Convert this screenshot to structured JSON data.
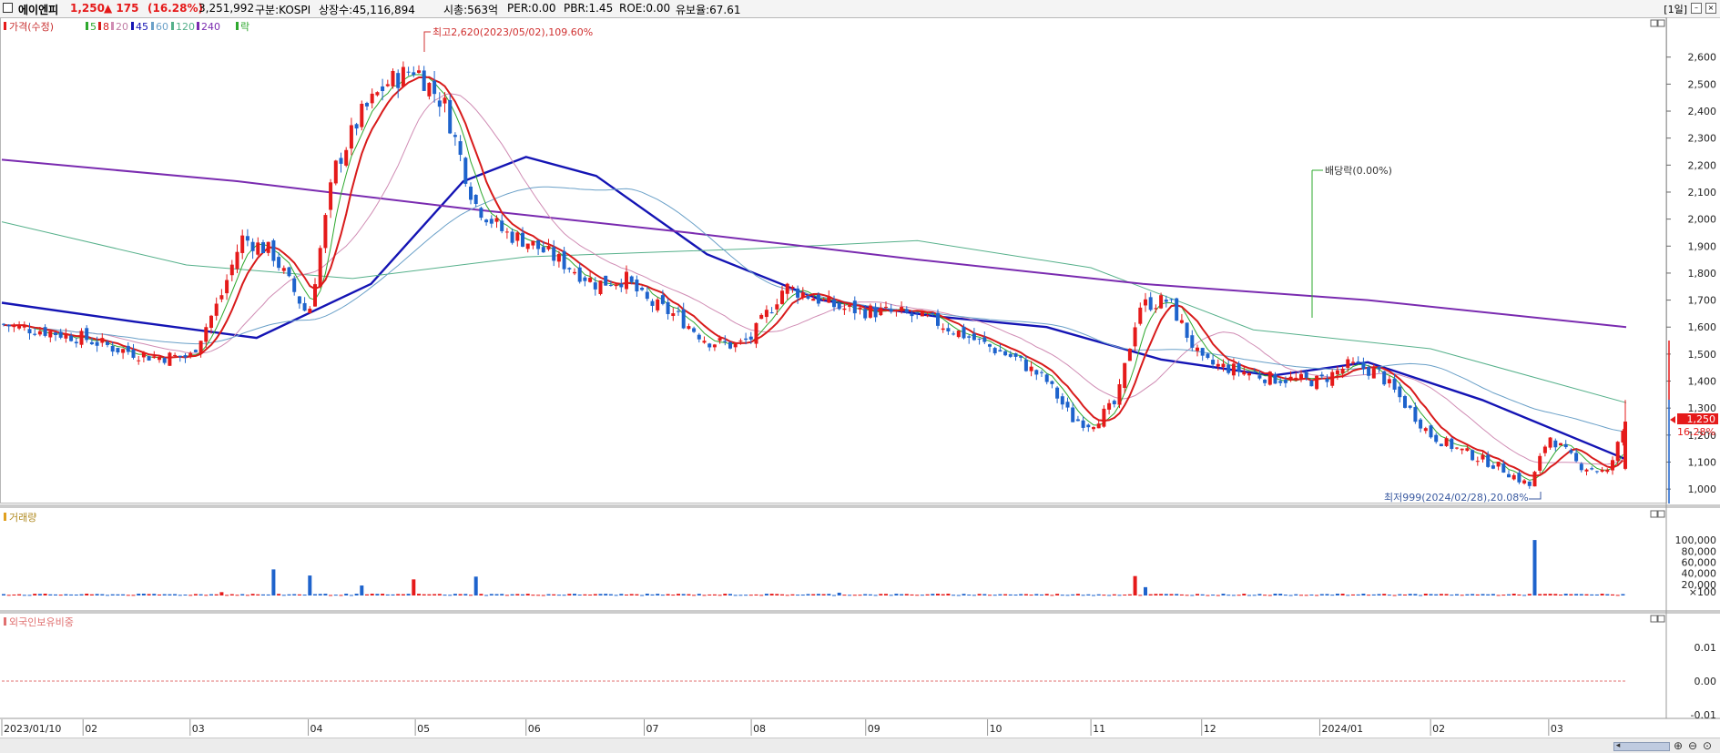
{
  "header": {
    "stock_name": "에이엔피",
    "price": "1,250",
    "change": "▲ 175",
    "change_pct": "(16.28%)",
    "volume": "3,251,992",
    "market": "구분:KOSPI",
    "shares": "상장수:45,116,894",
    "mktcap": "시총:563억",
    "per": "PER:0.00",
    "pbr": "PBR:1.45",
    "roe": "ROE:0.00",
    "float_ratio": "유보율:67.61",
    "period": "[1일]"
  },
  "legend": {
    "price_label": "가격(수정)",
    "ma_labels": [
      "5",
      "8",
      "20",
      "45",
      "60",
      "120",
      "240"
    ],
    "ex_label": "락",
    "volume_label": "거래량",
    "foreign_label": "외국인보유비중"
  },
  "annotations": {
    "high": "최고2,620(2023/05/02),109.60%",
    "low": "최저999(2024/02/28),20.08%",
    "dividend": "배당락(0.00%)",
    "current_price": "1,250",
    "current_pct": "16.28%"
  },
  "colors": {
    "up": "#e51a1a",
    "down": "#1e63cc",
    "ma5": "#2ea82e",
    "ma8": "#d81b1b",
    "ma20": "#d08cb4",
    "ma45": "#1414b4",
    "ma60": "#6aa0c8",
    "ma120": "#55b08a",
    "ma240": "#7a2bb0"
  },
  "chart_data": [
    {
      "type": "candlestick",
      "title": "",
      "y_ticks": [
        "1,000",
        "1,100",
        "1,200",
        "1,300",
        "1,400",
        "1,500",
        "1,600",
        "1,700",
        "1,800",
        "1,900",
        "2,000",
        "2,100",
        "2,200",
        "2,300",
        "2,400",
        "2,500",
        "2,600"
      ],
      "ylim": [
        960,
        2680
      ],
      "x_labels": [
        "2023/01/10",
        "02",
        "03",
        "04",
        "05",
        "06",
        "07",
        "08",
        "09",
        "10",
        "11",
        "12",
        "2024/01",
        "02",
        "03"
      ],
      "x_dates": [
        "2023-01-10",
        "2023-02-01",
        "2023-03-02",
        "2023-04-03",
        "2023-05-02",
        "2023-06-01",
        "2023-07-03",
        "2023-08-01",
        "2023-09-01",
        "2023-10-04",
        "2023-11-01",
        "2023-12-01",
        "2024-01-02",
        "2024-02-01",
        "2024-03-04"
      ],
      "x_range": [
        "2023-01-10",
        "2024-03-25"
      ],
      "series": [
        {
          "name": "가격(수정)",
          "x": [
            "2023-01-10",
            "2023-01-20",
            "2023-02-01",
            "2023-02-10",
            "2023-02-20",
            "2023-03-02",
            "2023-03-10",
            "2023-03-16",
            "2023-03-24",
            "2023-04-03",
            "2023-04-10",
            "2023-04-17",
            "2023-04-24",
            "2023-05-02",
            "2023-05-10",
            "2023-05-18",
            "2023-05-26",
            "2023-06-01",
            "2023-06-12",
            "2023-06-20",
            "2023-06-28",
            "2023-07-03",
            "2023-07-12",
            "2023-07-20",
            "2023-07-28",
            "2023-08-01",
            "2023-08-10",
            "2023-08-18",
            "2023-08-25",
            "2023-09-01",
            "2023-09-11",
            "2023-09-20",
            "2023-10-04",
            "2023-10-12",
            "2023-10-20",
            "2023-10-27",
            "2023-11-01",
            "2023-11-08",
            "2023-11-14",
            "2023-11-22",
            "2023-12-01",
            "2023-12-11",
            "2023-12-20",
            "2024-01-02",
            "2024-01-10",
            "2024-01-18",
            "2024-01-26",
            "2024-02-01",
            "2024-02-08",
            "2024-02-20",
            "2024-02-28",
            "2024-03-04",
            "2024-03-12",
            "2024-03-20",
            "2024-03-25"
          ],
          "y": [
            1610,
            1590,
            1560,
            1520,
            1490,
            1490,
            1700,
            1930,
            1880,
            1640,
            2180,
            2380,
            2500,
            2560,
            2420,
            2060,
            1950,
            1920,
            1830,
            1760,
            1780,
            1700,
            1640,
            1550,
            1530,
            1560,
            1750,
            1710,
            1670,
            1660,
            1650,
            1620,
            1530,
            1480,
            1400,
            1260,
            1240,
            1320,
            1680,
            1700,
            1470,
            1440,
            1410,
            1400,
            1460,
            1430,
            1300,
            1200,
            1150,
            1080,
            1010,
            1200,
            1090,
            1060,
            1250
          ]
        },
        {
          "name": "5",
          "x": [],
          "y": []
        },
        {
          "name": "8",
          "x": [],
          "y": []
        },
        {
          "name": "20",
          "x": [],
          "y": []
        },
        {
          "name": "45",
          "x": [
            "2023-01-10",
            "2023-02-15",
            "2023-03-20",
            "2023-04-20",
            "2023-05-15",
            "2023-06-01",
            "2023-06-20",
            "2023-07-20",
            "2023-08-20",
            "2023-09-20",
            "2023-10-20",
            "2023-11-20",
            "2023-12-20",
            "2024-01-15",
            "2024-02-15",
            "2024-03-25"
          ],
          "y": [
            1690,
            1620,
            1560,
            1760,
            2140,
            2230,
            2160,
            1870,
            1700,
            1640,
            1600,
            1480,
            1420,
            1470,
            1330,
            1110
          ]
        },
        {
          "name": "60",
          "x": [],
          "y": []
        },
        {
          "name": "120",
          "x": [
            "2023-01-10",
            "2023-03-01",
            "2023-04-15",
            "2023-06-01",
            "2023-08-01",
            "2023-09-15",
            "2023-11-01",
            "2023-12-15",
            "2024-02-01",
            "2024-03-25"
          ],
          "y": [
            1990,
            1830,
            1780,
            1860,
            1890,
            1920,
            1820,
            1590,
            1520,
            1320
          ]
        },
        {
          "name": "240",
          "x": [
            "2023-01-10",
            "2023-03-15",
            "2023-05-15",
            "2023-07-15",
            "2023-09-15",
            "2023-11-15",
            "2024-01-15",
            "2024-03-25"
          ],
          "y": [
            2220,
            2140,
            2040,
            1950,
            1850,
            1760,
            1700,
            1600
          ]
        }
      ]
    },
    {
      "type": "bar",
      "title": "거래량",
      "y_ticks": [
        "×100",
        "20,000",
        "40,000",
        "60,000",
        "80,000",
        "100,000"
      ],
      "ylim": [
        0,
        110000
      ],
      "series": [
        {
          "name": "거래량",
          "x": [
            "2023-01-10",
            "2023-02-10",
            "2023-03-10",
            "2023-03-24",
            "2023-04-03",
            "2023-04-17",
            "2023-05-02",
            "2023-05-18",
            "2023-06-20",
            "2023-08-25",
            "2023-11-13",
            "2023-11-16",
            "2024-01-18",
            "2024-02-29",
            "2024-03-25"
          ],
          "y": [
            2500,
            2000,
            6000,
            47000,
            36000,
            18000,
            29000,
            34000,
            2500,
            5000,
            35000,
            15000,
            2500,
            100000,
            32000
          ]
        }
      ]
    },
    {
      "type": "line",
      "title": "외국인보유비중",
      "y_ticks": [
        "0.01",
        "0.00",
        "-0.01"
      ],
      "ylim": [
        -0.0105,
        0.0105
      ],
      "series": [
        {
          "name": "외국인보유비중",
          "x": [
            "2023-01-10",
            "2024-03-25"
          ],
          "y": [
            0.0,
            0.0
          ]
        }
      ]
    }
  ]
}
